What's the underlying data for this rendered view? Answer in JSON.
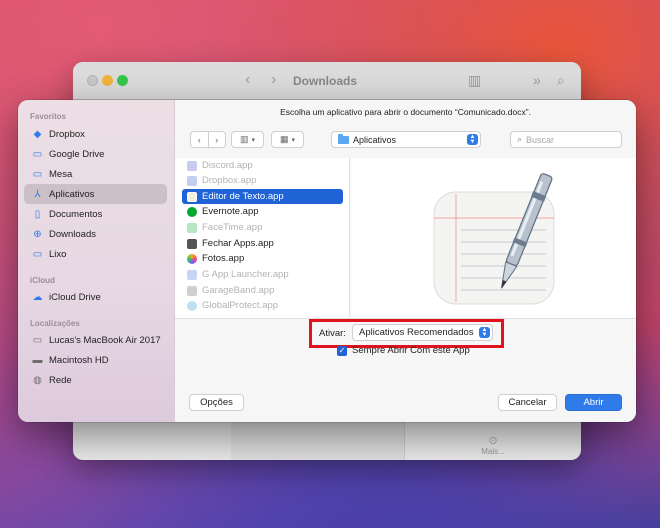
{
  "background_window": {
    "title": "Downloads",
    "more_label": "Mais..."
  },
  "dialog": {
    "prompt": "Escolha um aplicativo para abrir o documento “Comunicado.docx”.",
    "location": "Aplicativos",
    "search_placeholder": "Buscar",
    "sidebar": {
      "sections": [
        {
          "title": "Favoritos",
          "items": [
            {
              "label": "Dropbox",
              "icon": "dropbox-icon"
            },
            {
              "label": "Google Drive",
              "icon": "folder-icon"
            },
            {
              "label": "Mesa",
              "icon": "desktop-icon"
            },
            {
              "label": "Aplicativos",
              "icon": "applications-icon",
              "selected": true
            },
            {
              "label": "Documentos",
              "icon": "document-icon"
            },
            {
              "label": "Downloads",
              "icon": "download-icon"
            },
            {
              "label": "Lixo",
              "icon": "trash-icon"
            }
          ]
        },
        {
          "title": "iCloud",
          "items": [
            {
              "label": "iCloud Drive",
              "icon": "cloud-icon"
            }
          ]
        },
        {
          "title": "Localizações",
          "items": [
            {
              "label": "Lucas's MacBook Air 2017",
              "icon": "laptop-icon"
            },
            {
              "label": "Macintosh HD",
              "icon": "disk-icon"
            },
            {
              "label": "Rede",
              "icon": "network-icon"
            }
          ]
        }
      ]
    },
    "files": [
      {
        "name": "Discord.app",
        "enabled": false,
        "color": "#7289da"
      },
      {
        "name": "Dropbox.app",
        "enabled": false,
        "color": "#0061fe"
      },
      {
        "name": "Editor de Texto.app",
        "enabled": true,
        "selected": true,
        "color": "#f4f0e0"
      },
      {
        "name": "Evernote.app",
        "enabled": true,
        "color": "#00a82d"
      },
      {
        "name": "FaceTime.app",
        "enabled": false,
        "color": "#34c759"
      },
      {
        "name": "Fechar Apps.app",
        "enabled": true,
        "color": "#555555"
      },
      {
        "name": "Fotos.app",
        "enabled": true,
        "color": "#f5a623"
      },
      {
        "name": "G App Launcher.app",
        "enabled": false,
        "color": "#4285f4"
      },
      {
        "name": "GarageBand.app",
        "enabled": false,
        "color": "#9a9a9a"
      },
      {
        "name": "GlobalProtect.app",
        "enabled": false,
        "color": "#3ba3d6"
      }
    ],
    "ativar_label": "Ativar:",
    "ativar_value": "Aplicativos Recomendados",
    "checkbox_label": "Sempre Abrir Com este App",
    "checkbox_checked": true,
    "options_button": "Opções",
    "cancel_button": "Cancelar",
    "open_button": "Abrir"
  },
  "colors": {
    "accent": "#2f7bea",
    "selection": "#1f63d6",
    "highlight_box": "#e0121c"
  }
}
